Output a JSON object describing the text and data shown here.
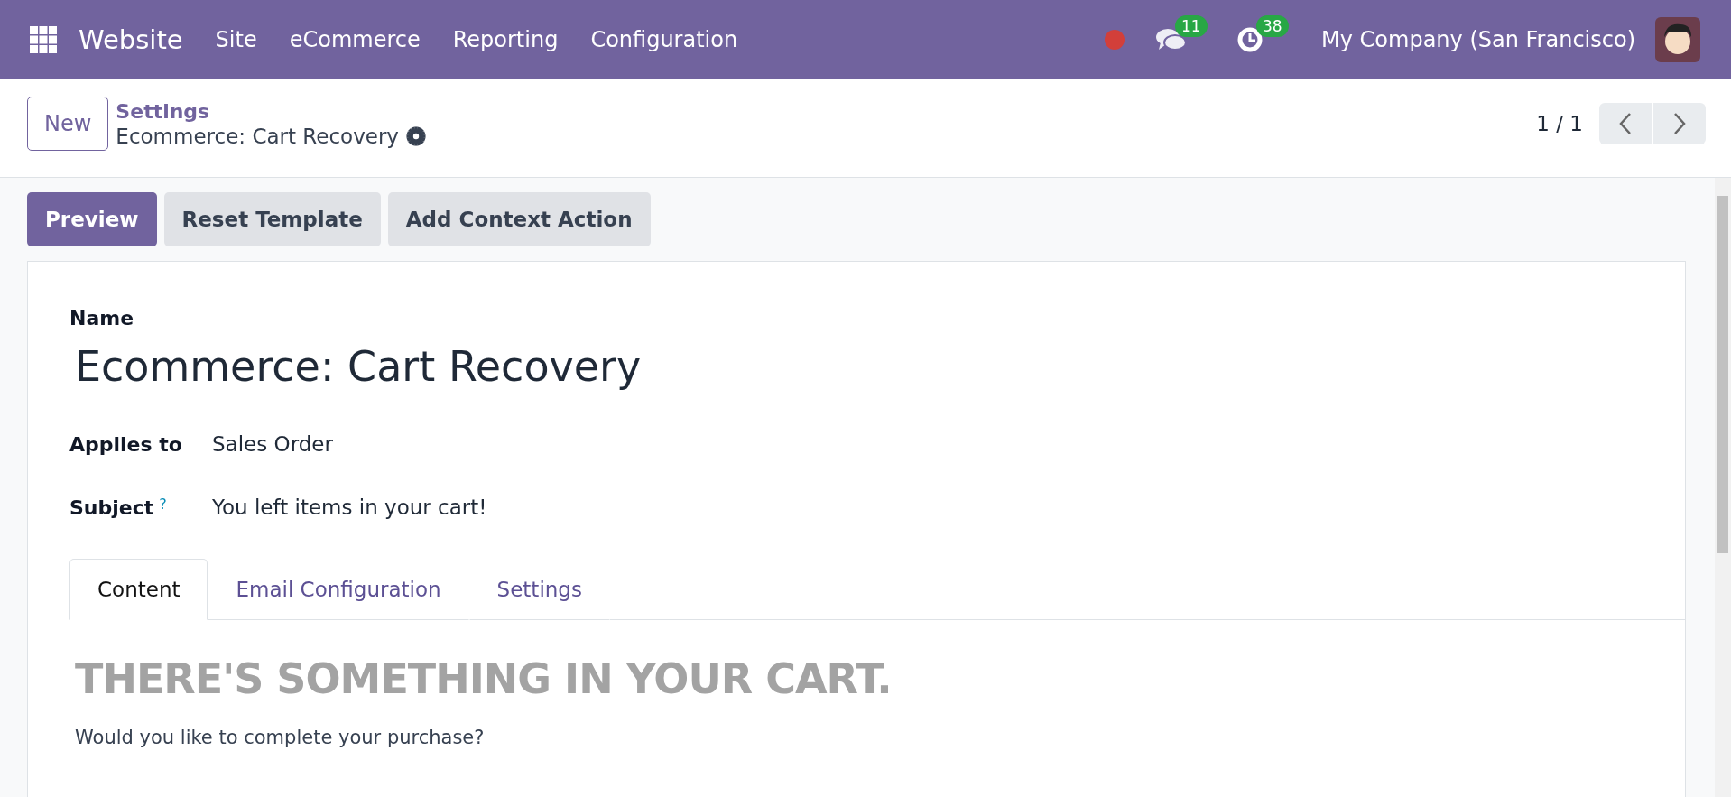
{
  "navbar": {
    "app_name": "Website",
    "menus": [
      "Site",
      "eCommerce",
      "Reporting",
      "Configuration"
    ],
    "messages_count": "11",
    "activities_count": "38",
    "company": "My Company (San Francisco)"
  },
  "control_panel": {
    "new_button": "New",
    "breadcrumb": "Settings",
    "record_title": "Ecommerce: Cart Recovery",
    "pager": "1 / 1"
  },
  "action_buttons": [
    {
      "label": "Preview",
      "primary": true
    },
    {
      "label": "Reset Template",
      "primary": false
    },
    {
      "label": "Add Context Action",
      "primary": false
    }
  ],
  "form": {
    "name_label": "Name",
    "name_value": "Ecommerce: Cart Recovery",
    "fields": [
      {
        "label": "Applies to",
        "value": "Sales Order",
        "help": false
      },
      {
        "label": "Subject",
        "value": "You left items in your cart!",
        "help": true
      }
    ],
    "help_mark": "?",
    "tabs": [
      {
        "label": "Content",
        "selected": true
      },
      {
        "label": "Email Configuration",
        "selected": false
      },
      {
        "label": "Settings",
        "selected": false
      }
    ],
    "content": {
      "heading": "THERE'S SOMETHING IN YOUR CART.",
      "text": "Would you like to complete your purchase?"
    }
  }
}
